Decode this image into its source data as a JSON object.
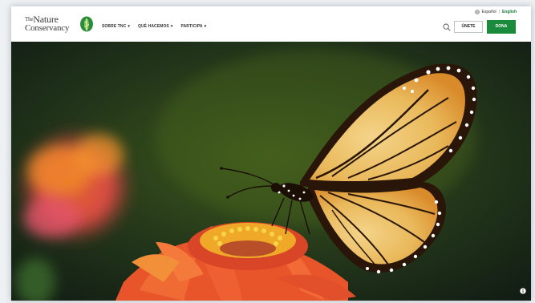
{
  "brand": {
    "logo_line1_small": "The",
    "logo_line1": "Nature",
    "logo_line2": "Conservancy",
    "accent": "#1a8a3c"
  },
  "nav": {
    "items": [
      {
        "label": "SOBRE TNC"
      },
      {
        "label": "QUÉ HACEMOS"
      },
      {
        "label": "PARTICIPA"
      }
    ]
  },
  "language": {
    "es": "Español",
    "separator": "|",
    "en": "English"
  },
  "actions": {
    "join_label": "ÚNETE",
    "donate_label": "DONA"
  },
  "icons": {
    "search": "search-icon",
    "globe": "globe-icon",
    "info": "info-icon",
    "chevron": "chevron-down-icon"
  }
}
